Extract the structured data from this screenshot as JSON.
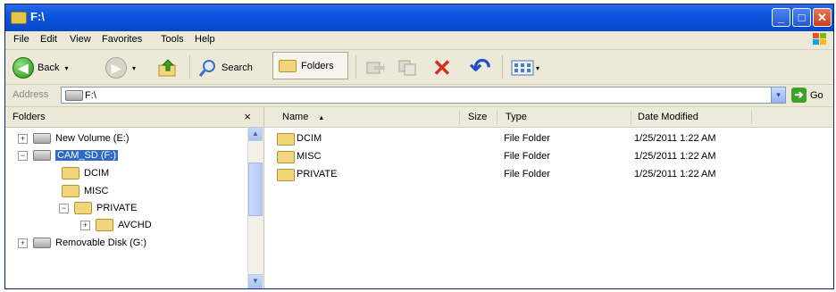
{
  "window": {
    "title": "F:\\",
    "minimize_glyph": "_",
    "maximize_glyph": "□",
    "close_glyph": "✕"
  },
  "menu": [
    "File",
    "Edit",
    "View",
    "Favorites",
    "Tools",
    "Help"
  ],
  "toolbar": {
    "back_label": "Back",
    "back_glyph": "◀",
    "forward_glyph": "▶",
    "search_label": "Search",
    "folders_label": "Folders",
    "delete_glyph": "✕",
    "undo_glyph": "↶",
    "dropdown_glyph": "▾"
  },
  "address": {
    "label": "Address",
    "value": "F:\\",
    "dropdown_glyph": "▾",
    "go_label": "Go",
    "go_glyph": "➔"
  },
  "folders_pane": {
    "title": "Folders",
    "close_glyph": "×",
    "tree": [
      {
        "label": "New Volume (E:)",
        "type": "drive",
        "expander": "+"
      },
      {
        "label": "CAM_SD (F:)",
        "type": "drive",
        "expander": "−",
        "selected": true
      },
      {
        "label": "DCIM",
        "type": "folder",
        "expander": ""
      },
      {
        "label": "MISC",
        "type": "folder",
        "expander": ""
      },
      {
        "label": "PRIVATE",
        "type": "folder",
        "expander": "−"
      },
      {
        "label": "AVCHD",
        "type": "folder",
        "expander": "+"
      },
      {
        "label": "Removable Disk (G:)",
        "type": "drive",
        "expander": "+"
      }
    ],
    "scroll_up_glyph": "▲",
    "scroll_down_glyph": "▼"
  },
  "columns": {
    "name": "Name",
    "sort_glyph": "▲",
    "size": "Size",
    "type": "Type",
    "date_modified": "Date Modified"
  },
  "files": [
    {
      "name": "DCIM",
      "size": "",
      "type": "File Folder",
      "date_modified": "1/25/2011 1:22 AM"
    },
    {
      "name": "MISC",
      "size": "",
      "type": "File Folder",
      "date_modified": "1/25/2011 1:22 AM"
    },
    {
      "name": "PRIVATE",
      "size": "",
      "type": "File Folder",
      "date_modified": "1/25/2011 1:22 AM"
    }
  ],
  "colors": {
    "titlebar": "#0a55e0",
    "selection": "#316ac5",
    "chrome": "#ece9d8",
    "folder": "#f1d67b"
  }
}
